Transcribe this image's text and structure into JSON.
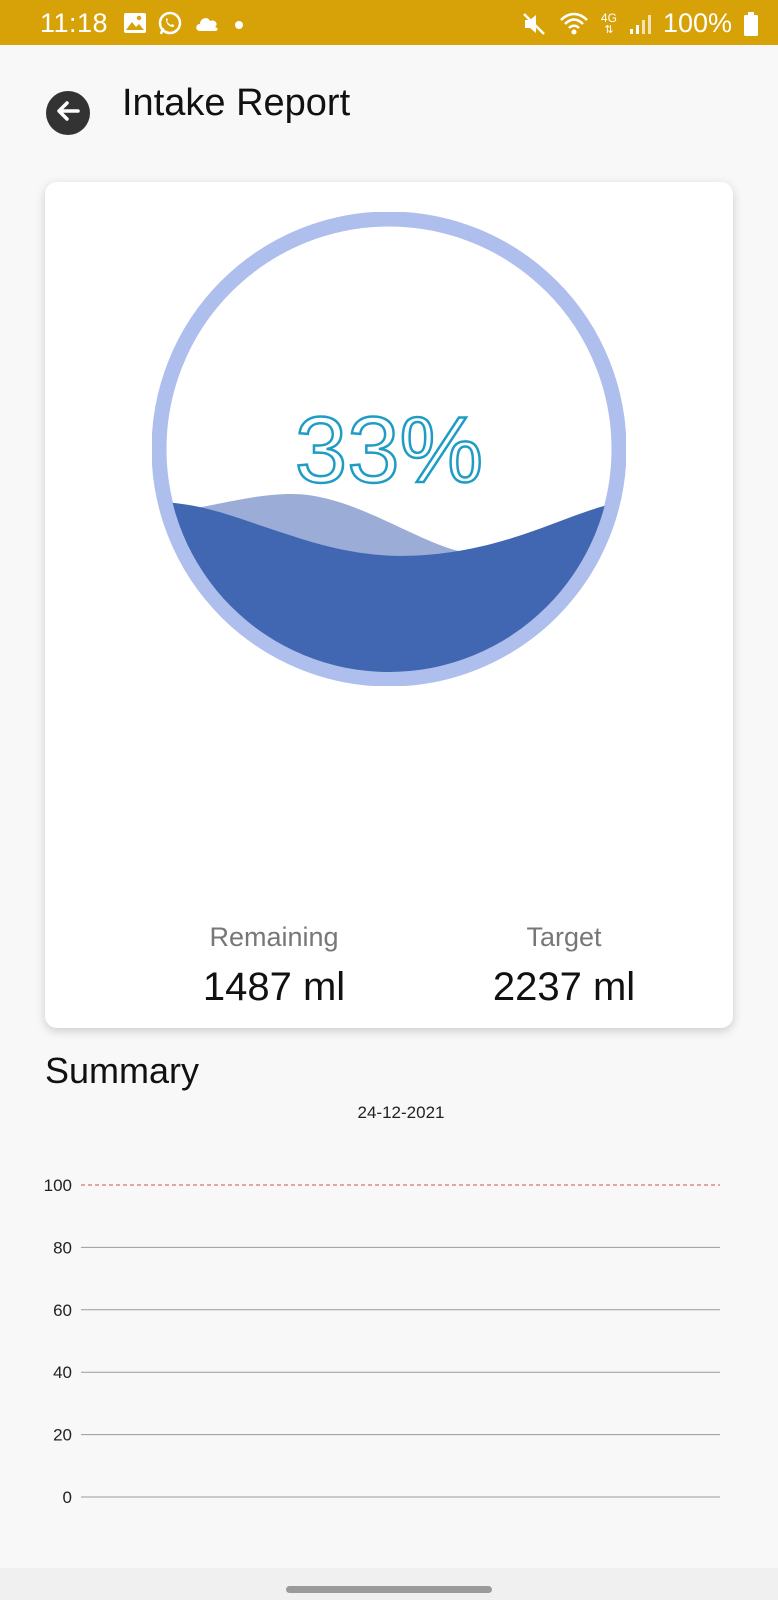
{
  "status_bar": {
    "time": "11:18",
    "battery": "100%",
    "network": "4G",
    "left_icons": [
      "gallery-icon",
      "whatsapp-icon",
      "cloud-icon",
      "dot-icon"
    ],
    "right_icons": [
      "mute-icon",
      "wifi-icon",
      "network-4g-icon",
      "signal-icon",
      "battery-icon"
    ],
    "background": "#d7a208"
  },
  "header": {
    "title": "Intake Report",
    "back_icon": "back-arrow-icon"
  },
  "gauge": {
    "percent_label": "33%",
    "fill_fraction": 0.33,
    "ring_color": "#aebeed",
    "water_color": "#4267b2",
    "back_wave_color": "#9badd6",
    "text_color": "#1f9cc4"
  },
  "stats": {
    "remaining_label": "Remaining",
    "remaining_value": "1487 ml",
    "target_label": "Target",
    "target_value": "2237 ml"
  },
  "summary": {
    "title": "Summary"
  },
  "chart_data": {
    "type": "line",
    "title": "24-12-2021",
    "xlabel": "",
    "ylabel": "",
    "ylim": [
      0,
      100
    ],
    "yticks": [
      "100",
      "80",
      "60",
      "40",
      "20",
      "0"
    ],
    "target_line": 100,
    "target_line_color": "#e07070",
    "series": []
  }
}
